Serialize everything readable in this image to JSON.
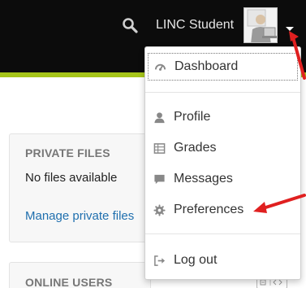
{
  "navbar": {
    "search_icon": "search-icon",
    "user_name": "LINC Student",
    "caret_icon": "caret-down-icon",
    "colors": {
      "background": "#0c0c0c",
      "accent": "#a6c51a"
    }
  },
  "user_menu": {
    "items": [
      {
        "label": "Dashboard",
        "icon": "dashboard-icon"
      },
      {
        "label": "Profile",
        "icon": "user-icon"
      },
      {
        "label": "Grades",
        "icon": "grades-icon"
      },
      {
        "label": "Messages",
        "icon": "message-icon"
      },
      {
        "label": "Preferences",
        "icon": "gear-icon"
      },
      {
        "label": "Log out",
        "icon": "sign-out-icon"
      }
    ]
  },
  "private_files": {
    "title": "PRIVATE FILES",
    "empty_text": "No files available",
    "manage_link": "Manage private files"
  },
  "online_users": {
    "title": "ONLINE USERS"
  },
  "annotation": {
    "arrow_color": "#e02020"
  }
}
